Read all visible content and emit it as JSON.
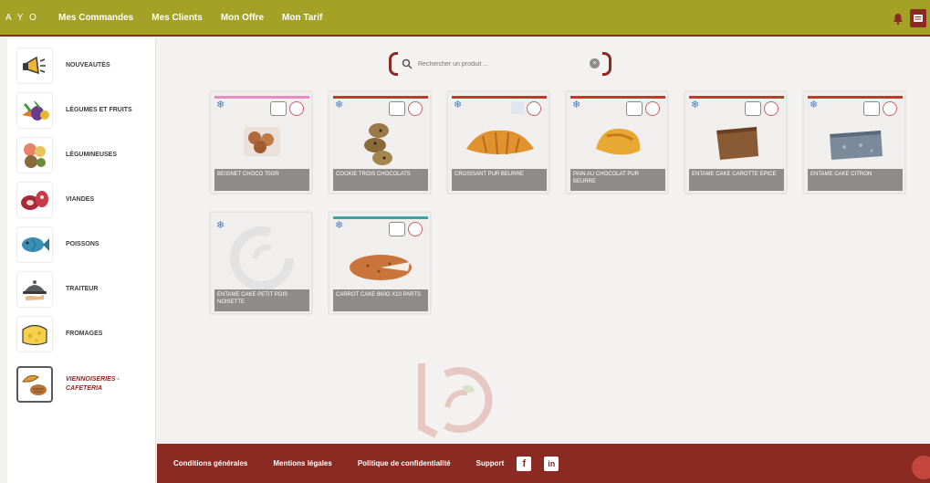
{
  "header": {
    "brand": "A Y O",
    "nav": [
      "Mes Commandes",
      "Mes Clients",
      "Mon Offre",
      "Mon Tarif"
    ]
  },
  "sidebar": {
    "items": [
      {
        "label": "NOUVEAUTÉS",
        "icon": "megaphone-icon"
      },
      {
        "label": "LÉGUMES ET FRUITS",
        "icon": "vegetables-icon"
      },
      {
        "label": "LÉGUMINEUSES",
        "icon": "legumes-icon"
      },
      {
        "label": "VIANDES",
        "icon": "meat-icon"
      },
      {
        "label": "POISSONS",
        "icon": "fish-icon"
      },
      {
        "label": "TRAITEUR",
        "icon": "cloche-icon"
      },
      {
        "label": "FROMAGES",
        "icon": "cheese-icon"
      },
      {
        "label": "VIENNOISERIES - CAFETERIA",
        "icon": "pastry-icon",
        "active": true
      }
    ]
  },
  "search": {
    "placeholder": "Rechercher un produit ...",
    "clear_label": "×"
  },
  "products": [
    {
      "name": "BEIGNET CHOCO 70GR",
      "stripe": "#e88bc4",
      "frozen": true
    },
    {
      "name": "COOKIE TROIS CHOCOLATS",
      "stripe": "#c0392b",
      "frozen": true
    },
    {
      "name": "CROISSANT PUR BEURRE",
      "stripe": "#c0392b",
      "frozen": true
    },
    {
      "name": "PAIN AU CHOCOLAT PUR BEURRE",
      "stripe": "#c0392b",
      "frozen": true
    },
    {
      "name": "ENTAME CAKE CAROTTE EPICE",
      "stripe": "#c0392b",
      "frozen": true
    },
    {
      "name": "ENTAME CAKE CITRON",
      "stripe": "#c0392b",
      "frozen": true
    },
    {
      "name": "ENTAME CAKE PETIT POIS NOISETTE",
      "stripe": "",
      "frozen": true
    },
    {
      "name": "CARROT CAKE 860g x10 PARTS",
      "stripe": "#3aa6a0",
      "frozen": true
    }
  ],
  "footer": {
    "links": [
      "Conditions générales",
      "Mentions légales",
      "Politique de confidentialité",
      "Support"
    ],
    "social": [
      {
        "label": "f",
        "icon": "facebook-icon"
      },
      {
        "label": "in",
        "icon": "linkedin-icon"
      }
    ]
  },
  "colors": {
    "nav_bg": "#a4a127",
    "brand_red": "#8a2a22",
    "frozen_blue": "#3a7fd6"
  }
}
